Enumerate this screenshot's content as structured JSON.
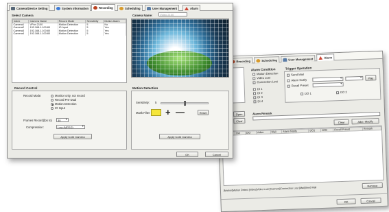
{
  "colors": {
    "window_bg": "#ebebe6",
    "mask_color": "#f5e63a",
    "accent": "#3d7bd8"
  },
  "front": {
    "tabs": [
      {
        "label": "Camera/Device Setting",
        "icon": "camera-icon"
      },
      {
        "label": "System Information",
        "icon": "info-icon"
      },
      {
        "label": "Recording",
        "icon": "record-icon"
      },
      {
        "label": "Scheduling",
        "icon": "clock-icon"
      },
      {
        "label": "User Management",
        "icon": "users-icon"
      },
      {
        "label": "Alarm",
        "icon": "alarm-icon"
      }
    ],
    "select_camera": {
      "title": "Select Camera",
      "columns": [
        "Index",
        "Camera Name",
        "Record Mode",
        "Sensitivity",
        "Motion Alarm"
      ],
      "rows": [
        [
          "Camera1",
          "VPon 2100",
          "Motion Detection",
          "5",
          "No"
        ],
        [
          "Camera2",
          "192.168.1.100:80",
          "IO Input",
          "5",
          "Yes"
        ],
        [
          "Camera3",
          "192.168.1.100:80",
          "Motion Detection",
          "5",
          "Yes"
        ],
        [
          "Camera4",
          "192.168.1.100:80",
          "Motion Detection",
          "5",
          "Yes"
        ]
      ]
    },
    "camera_name": {
      "label": "Camera Name:",
      "value": "Video 2100"
    },
    "record_control": {
      "title": "Record Control",
      "record_mode_label": "Record Mode:",
      "modes": [
        "Monitor only, not record",
        "Record Pre-Dual",
        "Motion Detection",
        "IO Input"
      ],
      "selected_mode": 2,
      "frames_label": "Frames Record(fps to)",
      "frames_value": "30",
      "compression_label": "Compression:",
      "compression_value": "Low (MPEG)",
      "apply_all": "Apply to All Camera"
    },
    "motion_detection": {
      "title": "Motion Detection",
      "sensitivity_label": "Sensitivity:",
      "sensitivity_value": "5",
      "sensitivity_level": 0.5,
      "mask_label": "Mask Filter",
      "add_symbol": "+",
      "remove_symbol": "—",
      "reset": "Reset",
      "apply_all": "Apply to All Camera"
    },
    "ok": "OK",
    "cancel": "Cancel"
  },
  "back": {
    "tabs": [
      {
        "label": "ation",
        "icon": ""
      },
      {
        "label": "Recording",
        "icon": "record-icon"
      },
      {
        "label": "Scheduling",
        "icon": "clock-icon"
      },
      {
        "label": "User Management",
        "icon": "users-icon"
      },
      {
        "label": "Alarm",
        "icon": "alarm-icon"
      }
    ],
    "alarm_condition": {
      "title": "Alarm Condition",
      "items": [
        "Motion Detection",
        "Video Lost",
        "Connection Lost",
        "DI 1",
        "DI 2",
        "DI 3",
        "DI 4"
      ]
    },
    "trigger_operation": {
      "title": "Trigger Operation",
      "sendmail": "Send Mail",
      "alarm_notify": "Alarm Notify",
      "recall_preset": "Recall Preset",
      "play": "Play",
      "do1": "DO 1",
      "do2": "DO 2"
    },
    "camera_label": "amera 1",
    "open": "Open",
    "clear_side": "Clear",
    "alarm_remark": {
      "label": "Alarm Remark"
    },
    "clear": "Clear",
    "add_modify": "Add / Modify",
    "columns": [
      "Cam",
      "Del",
      "DiO",
      "Video",
      "Mail",
      "Alarm Notify",
      "DO1",
      "DO2",
      "Recall Preset",
      "Remark"
    ],
    "legend": "[Motion]Motion Detect  [Video]Video Lost  [Connect]Connection Lost  [Mail]Send Mail",
    "remove": "Remove",
    "ok": "OK",
    "cancel": "Cancel"
  }
}
